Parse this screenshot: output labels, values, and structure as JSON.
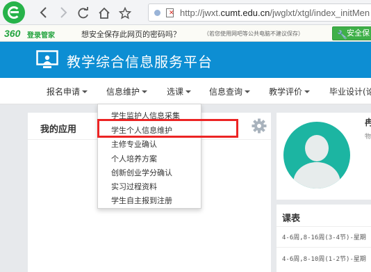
{
  "browser": {
    "url_prefix": "http://jwxt.",
    "url_domain": "cumt.edu.cn",
    "url_path": "/jwglxt/xtgl/index_initMen",
    "icons": [
      "360-browser-logo",
      "back-icon",
      "forward-icon",
      "refresh-icon",
      "home-icon",
      "star-icon"
    ]
  },
  "notice": {
    "brand_number": "360",
    "brand_name": "登录管家",
    "question": "想安全保存此网页的密码吗？",
    "tip": "（若您使用网吧等公共电脑不建议保存）",
    "safe_button": "安全保"
  },
  "header": {
    "title": "教学综合信息服务平台"
  },
  "nav": {
    "items": [
      {
        "label": "报名申请"
      },
      {
        "label": "信息维护"
      },
      {
        "label": "选课"
      },
      {
        "label": "信息查询"
      },
      {
        "label": "教学评价"
      },
      {
        "label": "毕业设计(论"
      }
    ]
  },
  "dropdown": {
    "items": [
      {
        "label": "学生监护人信息采集"
      },
      {
        "label": "学生个人信息维护"
      },
      {
        "label": "主修专业确认"
      },
      {
        "label": "个人培养方案"
      },
      {
        "label": "创新创业学分确认"
      },
      {
        "label": "实习过程资料"
      },
      {
        "label": "学生自主报到注册"
      }
    ],
    "highlighted_item": "学生个人信息维护",
    "highlight_color": "#ec2424"
  },
  "apps": {
    "title": "我的应用"
  },
  "profile": {
    "name": "冉",
    "subtitle": "物"
  },
  "schedule": {
    "title": "课表",
    "rows": [
      {
        "text": "4-6周,8-16周(3-4节)-星期"
      },
      {
        "text": "4-6周,8-10周(1-2节)-星期"
      }
    ]
  },
  "colors": {
    "header_blue": "#0d8ed3",
    "brand_green": "#23a43f",
    "avatar_teal": "#1cb5a2"
  }
}
